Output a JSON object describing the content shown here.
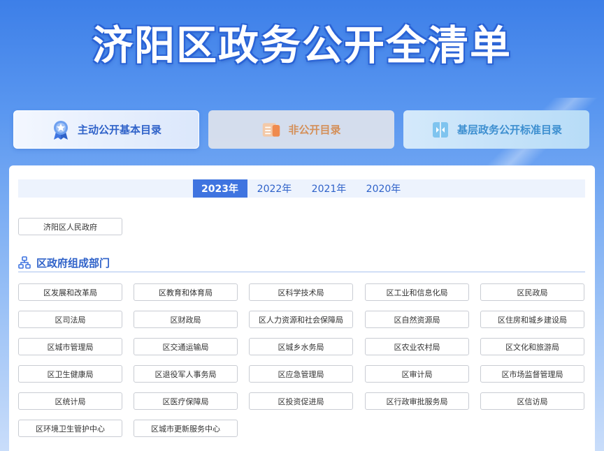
{
  "page_title": "济阳区政务公开全清单",
  "categories": [
    {
      "label": "主动公开基本目录",
      "icon": "medal-icon",
      "active": true
    },
    {
      "label": "非公开目录",
      "icon": "document-list-icon",
      "active": false
    },
    {
      "label": "基层政务公开标准目录",
      "icon": "book-icon",
      "active": false
    }
  ],
  "years": [
    "2023年",
    "2022年",
    "2021年",
    "2020年"
  ],
  "active_year": "2023年",
  "government": {
    "label": "济阳区人民政府"
  },
  "section": {
    "title": "区政府组成部门",
    "icon": "org-chart-icon"
  },
  "departments": [
    "区发展和改革局",
    "区教育和体育局",
    "区科学技术局",
    "区工业和信息化局",
    "区民政局",
    "区司法局",
    "区财政局",
    "区人力资源和社会保障局",
    "区自然资源局",
    "区住房和城乡建设局",
    "区城市管理局",
    "区交通运输局",
    "区城乡水务局",
    "区农业农村局",
    "区文化和旅游局",
    "区卫生健康局",
    "区退役军人事务局",
    "区应急管理局",
    "区审计局",
    "区市场监督管理局",
    "区统计局",
    "区医疗保障局",
    "区投资促进局",
    "区行政审批服务局",
    "区信访局",
    "区环境卫生管护中心",
    "区城市更新服务中心"
  ],
  "colors": {
    "accent": "#3f74e0",
    "title_stroke": "#2a63d6",
    "orange": "#d4905a"
  }
}
